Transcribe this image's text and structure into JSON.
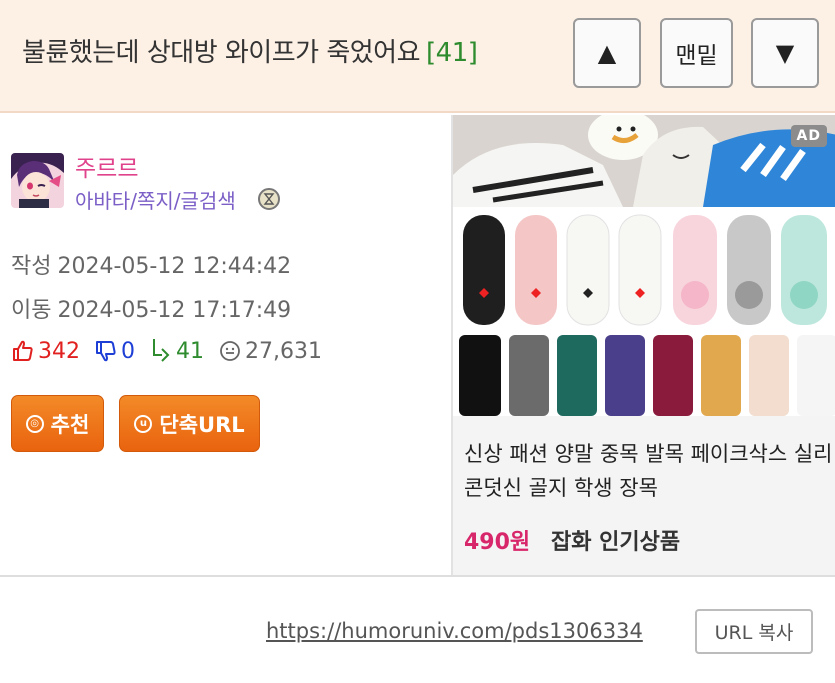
{
  "header": {
    "title": "불륜했는데 상대방 와이프가 죽었어요",
    "comment_count": "[41]",
    "nav_up": "▲",
    "nav_bottom": "맨밑",
    "nav_down": "▼"
  },
  "author": {
    "name": "주르르",
    "links": [
      "아바타",
      "쪽지",
      "글검색"
    ],
    "link_separator": "/",
    "level_icon": "level-badge-icon"
  },
  "dates": {
    "written_label": "작성",
    "written_value": "2024-05-12 12:44:42",
    "moved_label": "이동",
    "moved_value": "2024-05-12 17:17:49"
  },
  "stats": {
    "upvotes": "342",
    "downvotes": "0",
    "shares": "41",
    "views": "27,631"
  },
  "buttons": {
    "recommend": "추천",
    "short_url": "단축URL"
  },
  "ad": {
    "badge": "AD",
    "title": "신상 패션 양말 중목 발목 페이크삭스 실리콘덧신 골지 학생 장목",
    "price": "490원",
    "seller": "잡화 인기상품"
  },
  "footer": {
    "url": "https://humoruniv.com/pds1306334",
    "copy_button": "URL 복사"
  },
  "colors": {
    "header_bg": "#fdf1e6",
    "author_name": "#e0438c",
    "author_links": "#7b5fc7",
    "upvote": "#e0211f",
    "downvote": "#1d3fd6",
    "share": "#2e8b2e",
    "button_orange": "#ec6f16",
    "price": "#d8266a"
  }
}
